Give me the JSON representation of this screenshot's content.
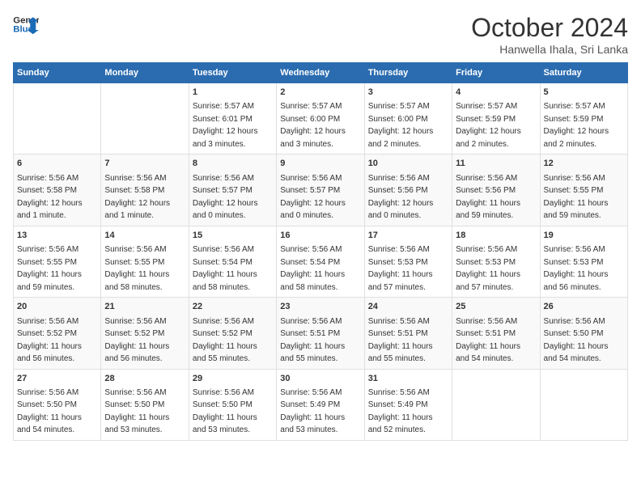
{
  "header": {
    "logo_line1": "General",
    "logo_line2": "Blue",
    "main_title": "October 2024",
    "subtitle": "Hanwella Ihala, Sri Lanka"
  },
  "days_of_week": [
    "Sunday",
    "Monday",
    "Tuesday",
    "Wednesday",
    "Thursday",
    "Friday",
    "Saturday"
  ],
  "weeks": [
    [
      {
        "day": "",
        "info": ""
      },
      {
        "day": "",
        "info": ""
      },
      {
        "day": "1",
        "info": "Sunrise: 5:57 AM\nSunset: 6:01 PM\nDaylight: 12 hours\nand 3 minutes."
      },
      {
        "day": "2",
        "info": "Sunrise: 5:57 AM\nSunset: 6:00 PM\nDaylight: 12 hours\nand 3 minutes."
      },
      {
        "day": "3",
        "info": "Sunrise: 5:57 AM\nSunset: 6:00 PM\nDaylight: 12 hours\nand 2 minutes."
      },
      {
        "day": "4",
        "info": "Sunrise: 5:57 AM\nSunset: 5:59 PM\nDaylight: 12 hours\nand 2 minutes."
      },
      {
        "day": "5",
        "info": "Sunrise: 5:57 AM\nSunset: 5:59 PM\nDaylight: 12 hours\nand 2 minutes."
      }
    ],
    [
      {
        "day": "6",
        "info": "Sunrise: 5:56 AM\nSunset: 5:58 PM\nDaylight: 12 hours\nand 1 minute."
      },
      {
        "day": "7",
        "info": "Sunrise: 5:56 AM\nSunset: 5:58 PM\nDaylight: 12 hours\nand 1 minute."
      },
      {
        "day": "8",
        "info": "Sunrise: 5:56 AM\nSunset: 5:57 PM\nDaylight: 12 hours\nand 0 minutes."
      },
      {
        "day": "9",
        "info": "Sunrise: 5:56 AM\nSunset: 5:57 PM\nDaylight: 12 hours\nand 0 minutes."
      },
      {
        "day": "10",
        "info": "Sunrise: 5:56 AM\nSunset: 5:56 PM\nDaylight: 12 hours\nand 0 minutes."
      },
      {
        "day": "11",
        "info": "Sunrise: 5:56 AM\nSunset: 5:56 PM\nDaylight: 11 hours\nand 59 minutes."
      },
      {
        "day": "12",
        "info": "Sunrise: 5:56 AM\nSunset: 5:55 PM\nDaylight: 11 hours\nand 59 minutes."
      }
    ],
    [
      {
        "day": "13",
        "info": "Sunrise: 5:56 AM\nSunset: 5:55 PM\nDaylight: 11 hours\nand 59 minutes."
      },
      {
        "day": "14",
        "info": "Sunrise: 5:56 AM\nSunset: 5:55 PM\nDaylight: 11 hours\nand 58 minutes."
      },
      {
        "day": "15",
        "info": "Sunrise: 5:56 AM\nSunset: 5:54 PM\nDaylight: 11 hours\nand 58 minutes."
      },
      {
        "day": "16",
        "info": "Sunrise: 5:56 AM\nSunset: 5:54 PM\nDaylight: 11 hours\nand 58 minutes."
      },
      {
        "day": "17",
        "info": "Sunrise: 5:56 AM\nSunset: 5:53 PM\nDaylight: 11 hours\nand 57 minutes."
      },
      {
        "day": "18",
        "info": "Sunrise: 5:56 AM\nSunset: 5:53 PM\nDaylight: 11 hours\nand 57 minutes."
      },
      {
        "day": "19",
        "info": "Sunrise: 5:56 AM\nSunset: 5:53 PM\nDaylight: 11 hours\nand 56 minutes."
      }
    ],
    [
      {
        "day": "20",
        "info": "Sunrise: 5:56 AM\nSunset: 5:52 PM\nDaylight: 11 hours\nand 56 minutes."
      },
      {
        "day": "21",
        "info": "Sunrise: 5:56 AM\nSunset: 5:52 PM\nDaylight: 11 hours\nand 56 minutes."
      },
      {
        "day": "22",
        "info": "Sunrise: 5:56 AM\nSunset: 5:52 PM\nDaylight: 11 hours\nand 55 minutes."
      },
      {
        "day": "23",
        "info": "Sunrise: 5:56 AM\nSunset: 5:51 PM\nDaylight: 11 hours\nand 55 minutes."
      },
      {
        "day": "24",
        "info": "Sunrise: 5:56 AM\nSunset: 5:51 PM\nDaylight: 11 hours\nand 55 minutes."
      },
      {
        "day": "25",
        "info": "Sunrise: 5:56 AM\nSunset: 5:51 PM\nDaylight: 11 hours\nand 54 minutes."
      },
      {
        "day": "26",
        "info": "Sunrise: 5:56 AM\nSunset: 5:50 PM\nDaylight: 11 hours\nand 54 minutes."
      }
    ],
    [
      {
        "day": "27",
        "info": "Sunrise: 5:56 AM\nSunset: 5:50 PM\nDaylight: 11 hours\nand 54 minutes."
      },
      {
        "day": "28",
        "info": "Sunrise: 5:56 AM\nSunset: 5:50 PM\nDaylight: 11 hours\nand 53 minutes."
      },
      {
        "day": "29",
        "info": "Sunrise: 5:56 AM\nSunset: 5:50 PM\nDaylight: 11 hours\nand 53 minutes."
      },
      {
        "day": "30",
        "info": "Sunrise: 5:56 AM\nSunset: 5:49 PM\nDaylight: 11 hours\nand 53 minutes."
      },
      {
        "day": "31",
        "info": "Sunrise: 5:56 AM\nSunset: 5:49 PM\nDaylight: 11 hours\nand 52 minutes."
      },
      {
        "day": "",
        "info": ""
      },
      {
        "day": "",
        "info": ""
      }
    ]
  ]
}
